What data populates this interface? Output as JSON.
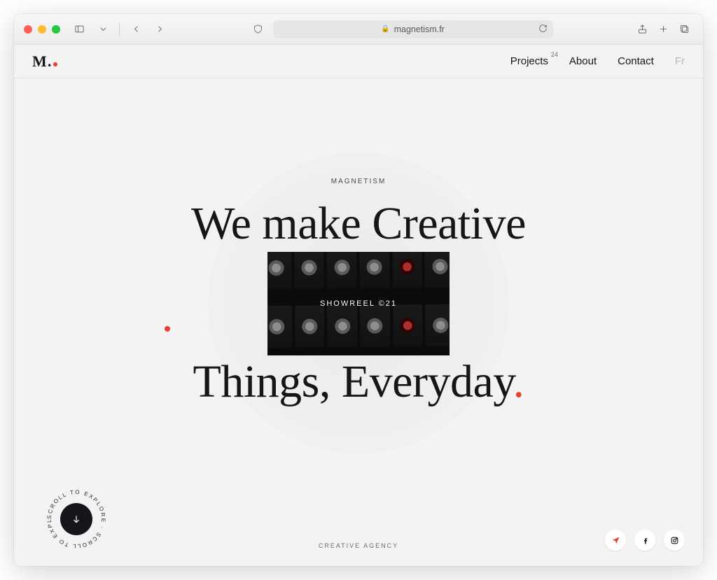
{
  "browser": {
    "url_display": "magnetism.fr"
  },
  "nav": {
    "projects": "Projects",
    "projects_count": "24",
    "about": "About",
    "contact": "Contact",
    "lang": "Fr"
  },
  "logo": {
    "letter": "M"
  },
  "hero": {
    "kicker": "MAGNETISM",
    "line1": "We make Creative",
    "line2_pre": "Things, Everyday",
    "line2_period": ".",
    "showreel_label": "SHOWREEL ©21"
  },
  "footer": {
    "tagline": "CREATIVE AGENCY",
    "scroll_text": "SCROLL TO EXPLORE · SCROLL TO EXPLORE · "
  }
}
